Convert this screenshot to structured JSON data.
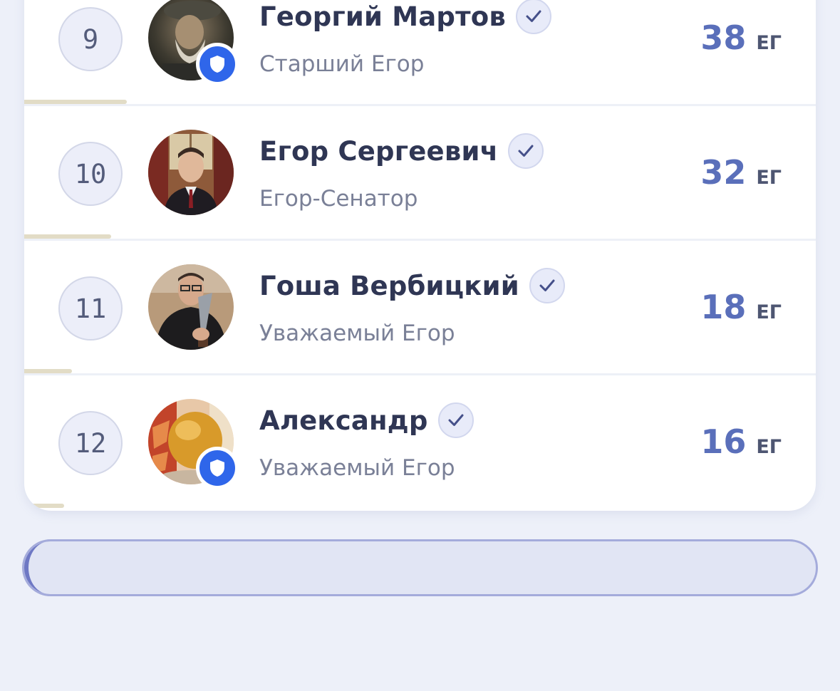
{
  "leaderboard": {
    "unit": "ЕГ",
    "rows": [
      {
        "rank": "9",
        "name": "Георгий Мартов",
        "title": "Старший Егор",
        "score": "38",
        "has_shield_badge": true,
        "progress": 0.13,
        "avatar_icon": "avatar-photo-old-man"
      },
      {
        "rank": "10",
        "name": "Егор Сергеевич",
        "title": "Егор-Сенатор",
        "score": "32",
        "has_shield_badge": false,
        "progress": 0.11,
        "avatar_icon": "avatar-photo-suit"
      },
      {
        "rank": "11",
        "name": "Гоша Вербицкий",
        "title": "Уважаемый Егор",
        "score": "18",
        "has_shield_badge": false,
        "progress": 0.06,
        "avatar_icon": "avatar-photo-knife"
      },
      {
        "rank": "12",
        "name": "Александр",
        "title": "Уважаемый Егор",
        "score": "16",
        "has_shield_badge": true,
        "progress": 0.05,
        "avatar_icon": "avatar-photo-food"
      }
    ]
  },
  "colors": {
    "page_background": "#edf0f9",
    "score_accent": "#5a6fba",
    "shield_badge": "#2f66ea",
    "progress_bar": "#e2dcc6",
    "button_border": "#a4abdb"
  },
  "load_button": {
    "label": "",
    "progress": 0.02
  }
}
